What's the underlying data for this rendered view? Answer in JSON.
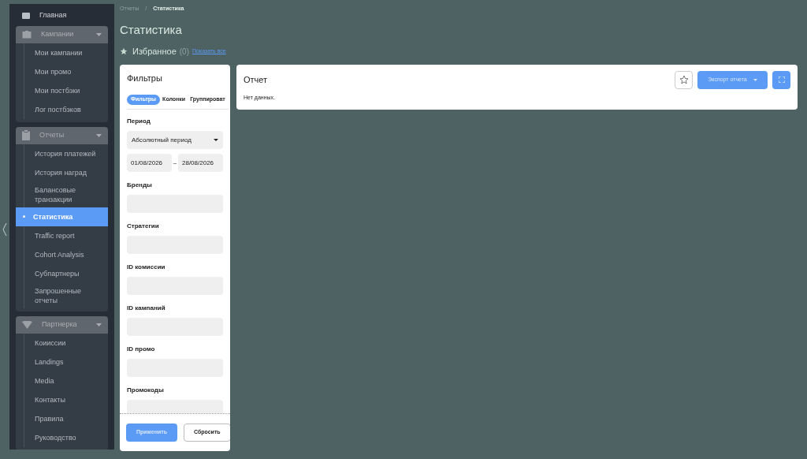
{
  "sidebar": {
    "items": [
      {
        "kind": "link",
        "label": "Главная",
        "selected": false
      },
      {
        "kind": "group",
        "label": "Кампании",
        "expanded": true,
        "children": [
          {
            "label": "Мои кампании",
            "selected": false
          },
          {
            "label": "Мои промо",
            "selected": false
          },
          {
            "label": "Мои постбэки",
            "selected": false
          },
          {
            "label": "Лог постбэков",
            "selected": false
          }
        ]
      },
      {
        "kind": "group",
        "label": "Отчеты",
        "expanded": true,
        "children": [
          {
            "label": "История платежей",
            "selected": false
          },
          {
            "label": "История наград",
            "selected": false
          },
          {
            "label": "Балансовые транзакции",
            "selected": false
          },
          {
            "label": "Статистика",
            "selected": true
          },
          {
            "label": "Traffic report",
            "selected": false
          },
          {
            "label": "Cohort Analysis",
            "selected": false
          },
          {
            "label": "Субпартнеры",
            "selected": false
          },
          {
            "label": "Запрошенные отчеты",
            "selected": false
          }
        ]
      },
      {
        "kind": "group",
        "label": "Партнерка",
        "expanded": true,
        "children": [
          {
            "label": "Коииссии",
            "selected": false
          },
          {
            "label": "Landings",
            "selected": false
          },
          {
            "label": "Media",
            "selected": false
          },
          {
            "label": "Контакты",
            "selected": false
          },
          {
            "label": "Правила",
            "selected": false
          },
          {
            "label": "Руководство",
            "selected": false
          }
        ]
      }
    ]
  },
  "breadcrumb": [
    "Отчеты",
    "/",
    "Статистика"
  ],
  "page_title": "Статистика",
  "favorites": {
    "label": "Избранное",
    "count": "(0)",
    "link": "Показать все"
  },
  "filters": {
    "title": "Фильтры",
    "tabs": [
      {
        "label": "Фильтры",
        "selected": true
      },
      {
        "label": "Колонки",
        "selected": false
      },
      {
        "label": "Группироват",
        "selected": false
      }
    ],
    "fields": [
      {
        "kind": "select",
        "label": "Период",
        "value": "Абсолютный период"
      },
      {
        "kind": "daterange",
        "from": "01/08/2026",
        "separator": "–",
        "to": "28/08/2026"
      },
      {
        "kind": "input",
        "label": "Бренды"
      },
      {
        "kind": "input",
        "label": "Стратегии"
      },
      {
        "kind": "input",
        "label": "ID комиссии"
      },
      {
        "kind": "input",
        "label": "ID кампаний"
      },
      {
        "kind": "input",
        "label": "ID промо"
      },
      {
        "kind": "input",
        "label": "Промокоды"
      }
    ],
    "apply": "Применить",
    "reset": "Сбросить"
  },
  "report": {
    "title": "Отчет",
    "empty": "Нет данных.",
    "export": "Экспорт отчета"
  }
}
